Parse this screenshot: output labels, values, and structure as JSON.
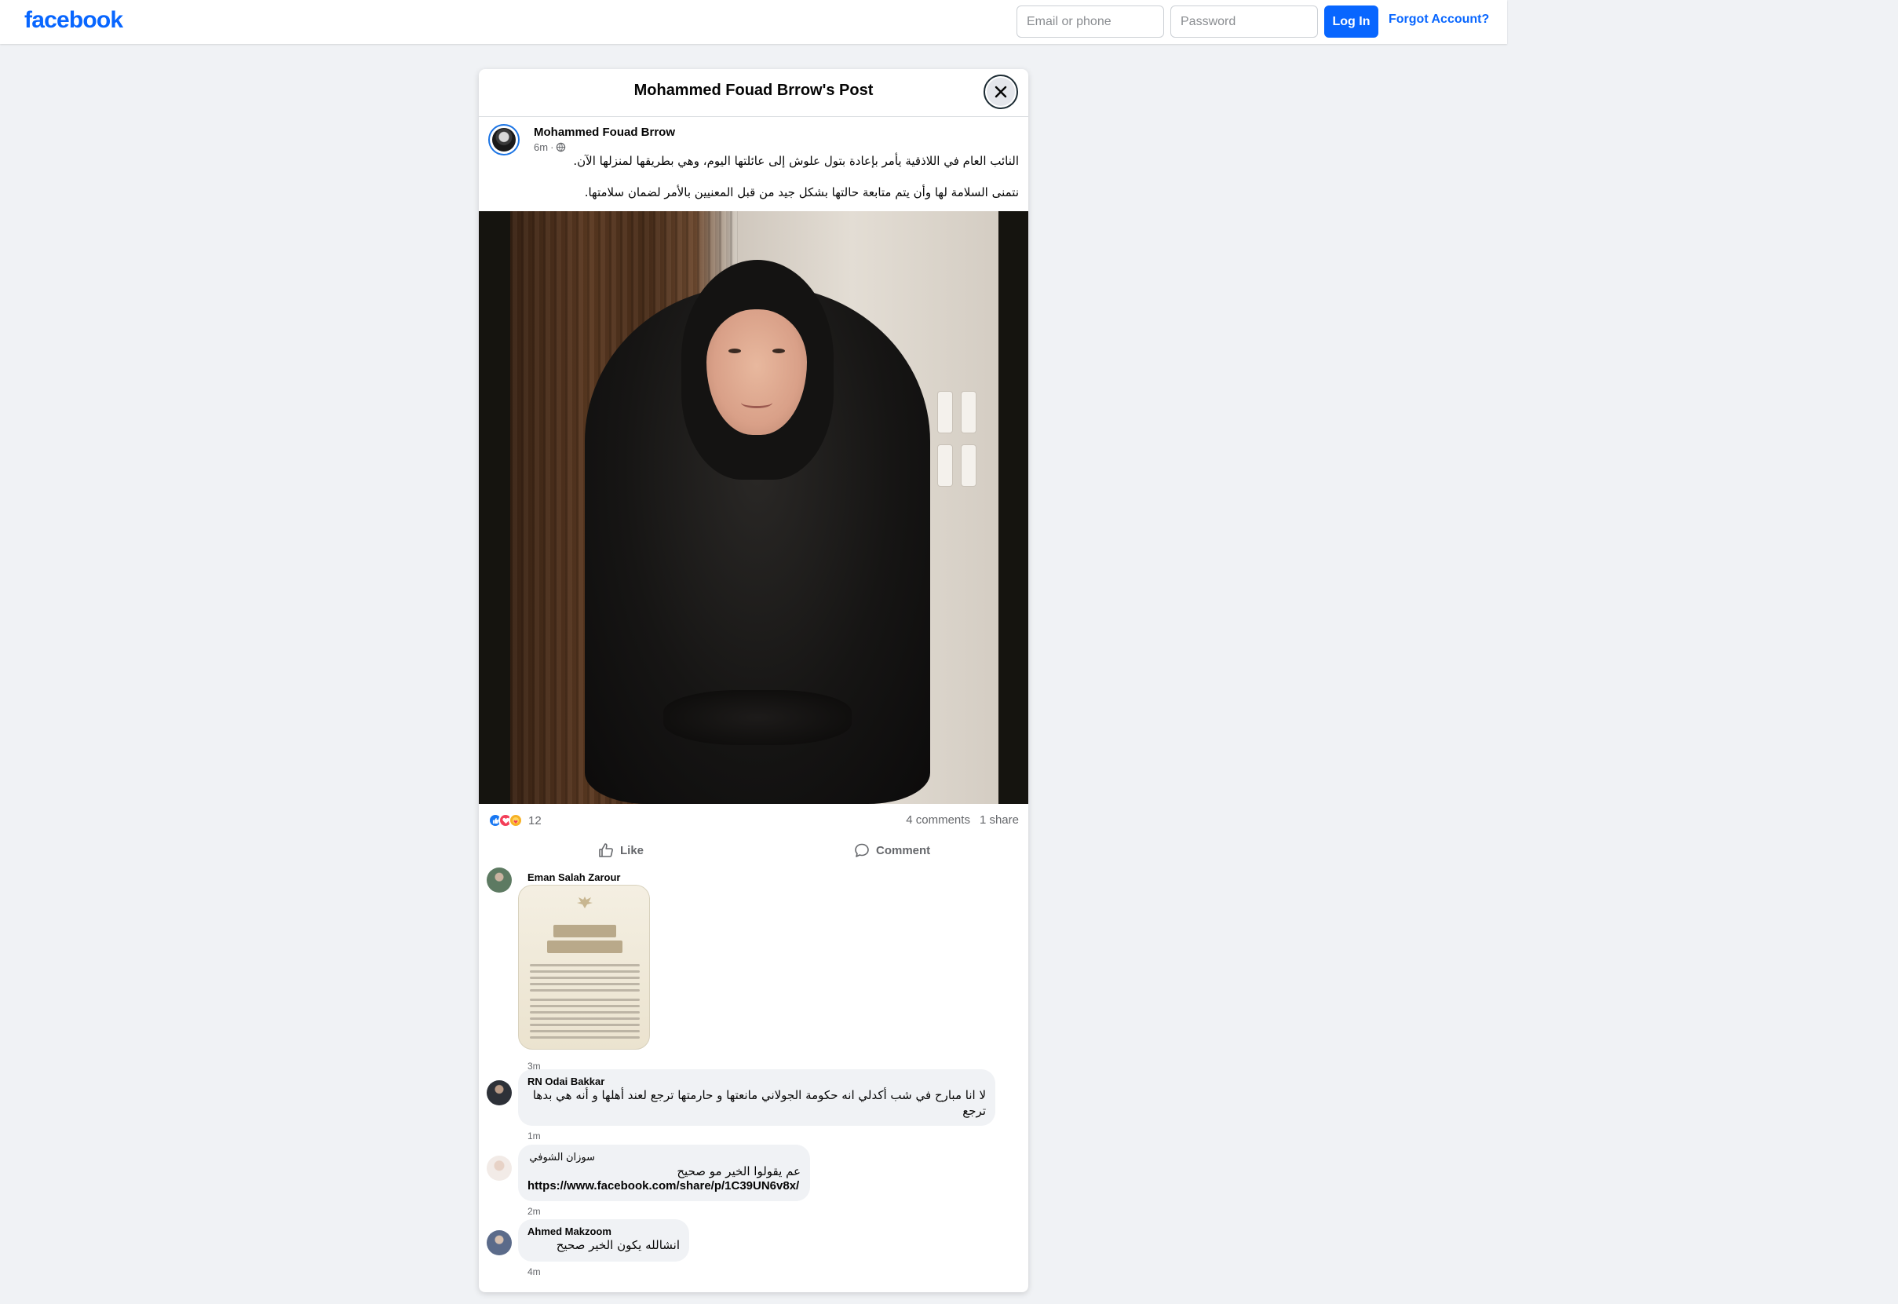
{
  "topbar": {
    "logo": "facebook",
    "email_placeholder": "Email or phone",
    "password_placeholder": "Password",
    "login_label": "Log In",
    "forgot_label": "Forgot Account?"
  },
  "modal": {
    "title": "Mohammed Fouad Brrow's Post",
    "close_icon": "close-icon"
  },
  "post": {
    "author": "Mohammed Fouad Brrow",
    "time": "6m",
    "audience_icon": "globe-icon",
    "paragraphs": [
      "النائب العام في اللاذقية يأمر بإعادة بتول علوش إلى عائلتها اليوم، وهي بطريقها لمنزلها الآن.",
      "نتمنى السلامة لها وأن يتم متابعة حالتها بشكل جيد من قبل المعنيين بالأمر لضمان سلامتها."
    ],
    "reactions": [
      "like",
      "love",
      "care"
    ],
    "reaction_count": "12",
    "comments_count": "4 comments",
    "shares_count": "1 share",
    "like_label": "Like",
    "comment_label": "Comment"
  },
  "comments": [
    {
      "name": "Eman Salah Zarour",
      "text": "",
      "time": "3m",
      "has_image": true
    },
    {
      "name": "RN Odai Bakkar",
      "text": "لا انا مبارح في شب أكدلي انه حكومة الجولاني مانعتها و حارمتها ترجع لعند أهلها و أنه هي بدها ترجع",
      "time": "1m"
    },
    {
      "name": "سوزان الشوفي",
      "text": "عم يقولوا الخير مو صحيح",
      "link": "https://www.facebook.com/share/p/1C39UN6v8x/",
      "time": "2m"
    },
    {
      "name": "Ahmed Makzoom",
      "text": "انشالله يكون الخير صحيح",
      "time": "4m"
    }
  ],
  "colors": {
    "brand": "#0866ff",
    "page_bg": "#f0f2f5",
    "secondary_text": "#65676b"
  }
}
